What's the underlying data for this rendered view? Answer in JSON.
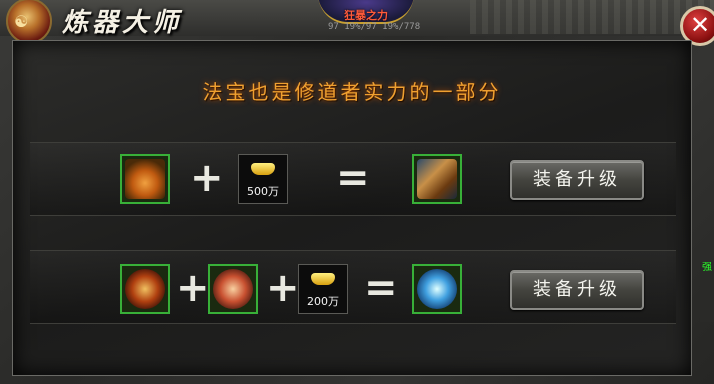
{
  "window": {
    "title": "炼器大师",
    "top_badge": "狂暴之力",
    "top_stats": "97 19%/97 19%/778",
    "close_symbol": "✕"
  },
  "panel": {
    "headline": "法宝也是修道者实力的一部分"
  },
  "recipes": [
    {
      "inputs": [
        {
          "type": "item",
          "icon": "gourd-icon"
        },
        {
          "type": "money",
          "icon": "gold-ingot-icon",
          "amount": "500万"
        }
      ],
      "plus": "+",
      "equals": "=",
      "result_icon": "cannon-icon",
      "button_label": "装备升级"
    },
    {
      "inputs": [
        {
          "type": "item",
          "icon": "red-orb-icon"
        },
        {
          "type": "item",
          "icon": "pink-orb-icon"
        },
        {
          "type": "money",
          "icon": "gold-ingot-icon",
          "amount": "200万"
        }
      ],
      "plus": "+",
      "equals": "=",
      "result_icon": "blue-orb-icon",
      "button_label": "装备升级"
    }
  ],
  "side_tag": "强",
  "colors": {
    "headline": "#f0a030",
    "item_border_green": "#38b038",
    "close_red": "#c82020"
  }
}
